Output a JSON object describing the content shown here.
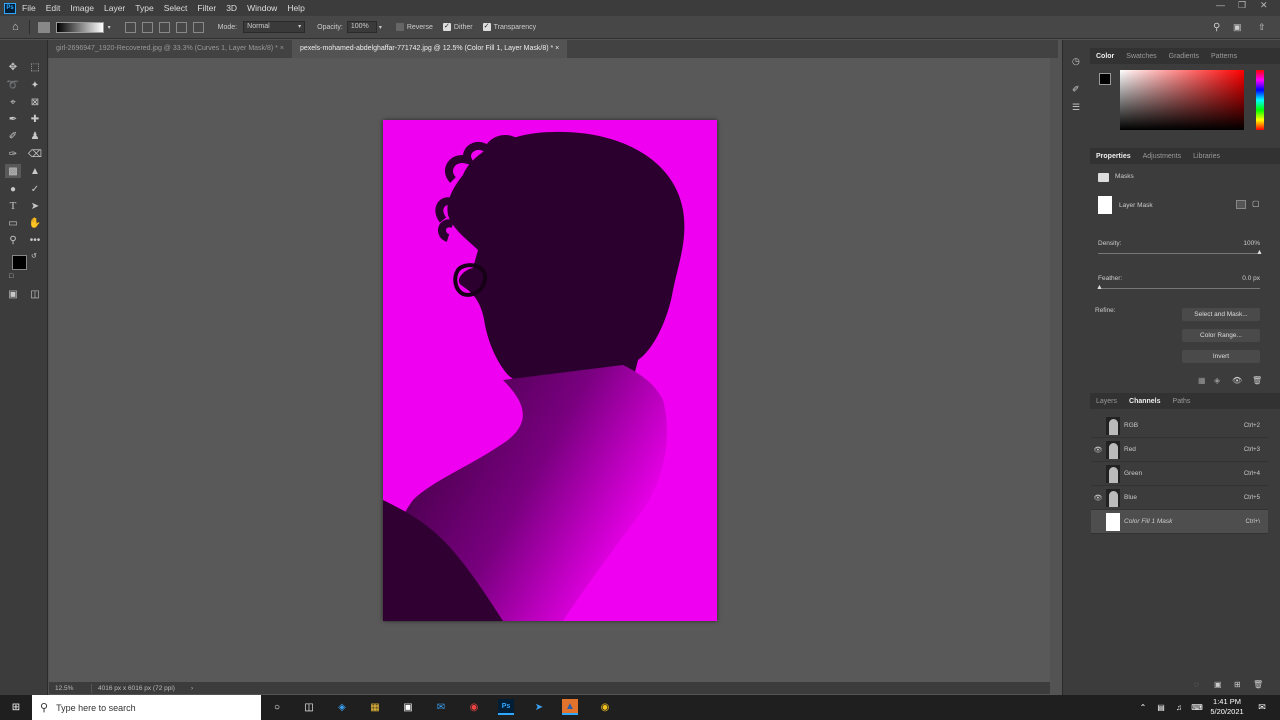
{
  "app": {
    "menus": [
      "File",
      "Edit",
      "Image",
      "Layer",
      "Type",
      "Select",
      "Filter",
      "3D",
      "Window",
      "Help"
    ]
  },
  "options": {
    "mode_label": "Mode:",
    "mode_value": "Normal",
    "opacity_label": "Opacity:",
    "opacity_value": "100%",
    "reverse_label": "Reverse",
    "dither_label": "Dither",
    "transparency_label": "Transparency"
  },
  "tabs": [
    {
      "label": "girl-2696947_1920-Recovered.jpg @ 33.3% (Curves 1, Layer Mask/8) *"
    },
    {
      "label": "pexels-mohamed-abdelghaffar-771742.jpg @ 12.5% (Color Fill 1, Layer Mask/8) *"
    }
  ],
  "status": {
    "zoom": "12.5%",
    "doc_info": "4016 px x 6016 px (72 ppi)"
  },
  "color_panel": {
    "tabs": [
      "Color",
      "Swatches",
      "Gradients",
      "Patterns"
    ]
  },
  "properties": {
    "tabs": [
      "Properties",
      "Adjustments",
      "Libraries"
    ],
    "section": "Masks",
    "mask_label": "Layer Mask",
    "density_label": "Density:",
    "density_value": "100%",
    "feather_label": "Feather:",
    "feather_value": "0.0 px",
    "refine_label": "Refine:",
    "select_mask_btn": "Select and Mask...",
    "color_range_btn": "Color Range...",
    "invert_btn": "Invert"
  },
  "layers_panel": {
    "tabs": [
      "Layers",
      "Channels",
      "Paths"
    ],
    "channels": [
      {
        "name": "RGB",
        "shortcut": "Ctrl+2",
        "visible": false
      },
      {
        "name": "Red",
        "shortcut": "Ctrl+3",
        "visible": true
      },
      {
        "name": "Green",
        "shortcut": "Ctrl+4",
        "visible": false
      },
      {
        "name": "Blue",
        "shortcut": "Ctrl+5",
        "visible": true
      },
      {
        "name": "Color Fill 1 Mask",
        "shortcut": "Ctrl+\\",
        "visible": false
      }
    ]
  },
  "taskbar": {
    "search_placeholder": "Type here to search",
    "time": "1:41 PM",
    "date": "5/20/2021"
  },
  "colors": {
    "canvas_fill": "#f000f0",
    "accent": "#31a8ff"
  }
}
